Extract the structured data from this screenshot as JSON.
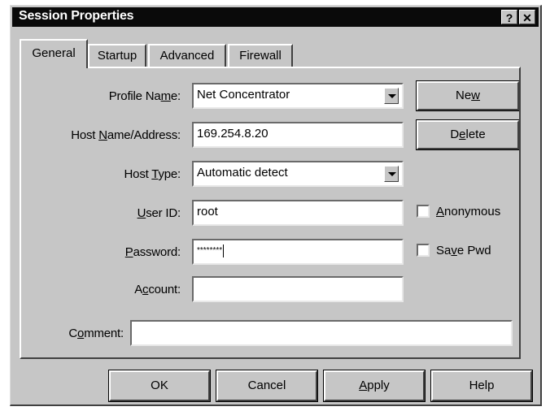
{
  "window": {
    "title": "Session Properties",
    "help_glyph": "?",
    "close_glyph": "✕"
  },
  "tabs": [
    {
      "label": "General",
      "active": true
    },
    {
      "label": "Startup",
      "active": false
    },
    {
      "label": "Advanced",
      "active": false
    },
    {
      "label": "Firewall",
      "active": false
    }
  ],
  "form": {
    "profile_name": {
      "label_pre": "Profile Na",
      "label_u": "m",
      "label_post": "e:",
      "value": "Net Concentrator"
    },
    "host_name": {
      "label_pre": "Host ",
      "label_u": "N",
      "label_post": "ame/Address:",
      "value": "169.254.8.20"
    },
    "host_type": {
      "label_pre": "Host ",
      "label_u": "T",
      "label_post": "ype:",
      "value": "Automatic detect"
    },
    "user_id": {
      "label_pre": "",
      "label_u": "U",
      "label_post": "ser ID:",
      "value": "root"
    },
    "password": {
      "label_pre": "",
      "label_u": "P",
      "label_post": "assword:",
      "value": "********"
    },
    "account": {
      "label_pre": "A",
      "label_u": "c",
      "label_post": "count:",
      "value": ""
    },
    "comment": {
      "label_pre": "C",
      "label_u": "o",
      "label_post": "mment:",
      "value": ""
    }
  },
  "side_buttons": {
    "new": {
      "pre": "Ne",
      "u": "w",
      "post": ""
    },
    "delete": {
      "pre": "D",
      "u": "e",
      "post": "lete"
    }
  },
  "checkboxes": {
    "anonymous": {
      "pre": "",
      "u": "A",
      "post": "nonymous",
      "checked": false
    },
    "save_pwd": {
      "pre": "Sa",
      "u": "v",
      "post": "e Pwd",
      "checked": false
    }
  },
  "footer": {
    "ok": {
      "pre": "OK",
      "u": "",
      "post": ""
    },
    "cancel": {
      "pre": "Cancel",
      "u": "",
      "post": ""
    },
    "apply": {
      "pre": "",
      "u": "A",
      "post": "pply"
    },
    "help": {
      "pre": "Help",
      "u": "",
      "post": ""
    }
  }
}
